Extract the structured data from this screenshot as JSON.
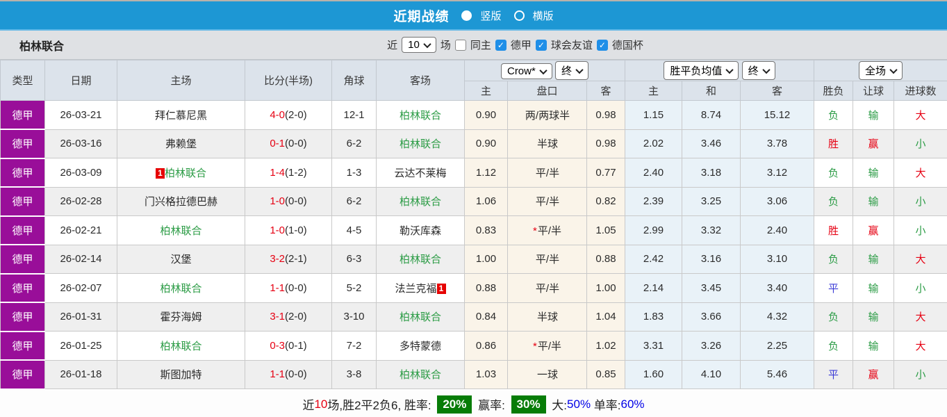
{
  "title_bar": {
    "title": "近期战绩",
    "radio_vertical": {
      "label": "竖版",
      "selected": true
    },
    "radio_horizontal": {
      "label": "横版",
      "selected": false
    }
  },
  "filter_bar": {
    "team_name": "柏林联合",
    "near_label": "近",
    "count_select": "10",
    "games_label": "场",
    "checkboxes": [
      {
        "label": "同主",
        "checked": false
      },
      {
        "label": "德甲",
        "checked": true
      },
      {
        "label": "球会友谊",
        "checked": true
      },
      {
        "label": "德国杯",
        "checked": true
      }
    ]
  },
  "table": {
    "main_headers": [
      "类型",
      "日期",
      "主场",
      "比分(半场)",
      "角球",
      "客场"
    ],
    "selects": {
      "handicap_source": "Crow*",
      "handicap_period": "终",
      "odds_source": "胜平负均值",
      "odds_period": "终",
      "scope": "全场"
    },
    "sub_headers": [
      "主",
      "盘口",
      "客",
      "主",
      "和",
      "客",
      "胜负",
      "让球",
      "进球数"
    ],
    "rows": [
      {
        "league": "德甲",
        "date": "26-03-21",
        "home": "拜仁慕尼黑",
        "home_badge": "",
        "home_is_team": false,
        "score": "4-0",
        "half": "(2-0)",
        "corner": "12-1",
        "away": "柏林联合",
        "away_badge": "",
        "away_is_team": true,
        "ah_home": "0.90",
        "ah_star": "",
        "ah_line": "两/两球半",
        "ah_away": "0.98",
        "odd_home": "1.15",
        "odd_draw": "8.74",
        "odd_away": "15.12",
        "res": "负",
        "res_color": "green",
        "ahres": "输",
        "ahres_color": "green",
        "goal": "大",
        "goal_color": "red"
      },
      {
        "league": "德甲",
        "date": "26-03-16",
        "home": "弗赖堡",
        "home_badge": "",
        "home_is_team": false,
        "score": "0-1",
        "half": "(0-0)",
        "corner": "6-2",
        "away": "柏林联合",
        "away_badge": "",
        "away_is_team": true,
        "ah_home": "0.90",
        "ah_star": "",
        "ah_line": "半球",
        "ah_away": "0.98",
        "odd_home": "2.02",
        "odd_draw": "3.46",
        "odd_away": "3.78",
        "res": "胜",
        "res_color": "red",
        "ahres": "赢",
        "ahres_color": "red",
        "goal": "小",
        "goal_color": "green"
      },
      {
        "league": "德甲",
        "date": "26-03-09",
        "home": "柏林联合",
        "home_badge": "1",
        "home_is_team": true,
        "score": "1-4",
        "half": "(1-2)",
        "corner": "1-3",
        "away": "云达不莱梅",
        "away_badge": "",
        "away_is_team": false,
        "ah_home": "1.12",
        "ah_star": "",
        "ah_line": "平/半",
        "ah_away": "0.77",
        "odd_home": "2.40",
        "odd_draw": "3.18",
        "odd_away": "3.12",
        "res": "负",
        "res_color": "green",
        "ahres": "输",
        "ahres_color": "green",
        "goal": "大",
        "goal_color": "red"
      },
      {
        "league": "德甲",
        "date": "26-02-28",
        "home": "门兴格拉德巴赫",
        "home_badge": "",
        "home_is_team": false,
        "score": "1-0",
        "half": "(0-0)",
        "corner": "6-2",
        "away": "柏林联合",
        "away_badge": "",
        "away_is_team": true,
        "ah_home": "1.06",
        "ah_star": "",
        "ah_line": "平/半",
        "ah_away": "0.82",
        "odd_home": "2.39",
        "odd_draw": "3.25",
        "odd_away": "3.06",
        "res": "负",
        "res_color": "green",
        "ahres": "输",
        "ahres_color": "green",
        "goal": "小",
        "goal_color": "green"
      },
      {
        "league": "德甲",
        "date": "26-02-21",
        "home": "柏林联合",
        "home_badge": "",
        "home_is_team": true,
        "score": "1-0",
        "half": "(1-0)",
        "corner": "4-5",
        "away": "勒沃库森",
        "away_badge": "",
        "away_is_team": false,
        "ah_home": "0.83",
        "ah_star": "*",
        "ah_line": "平/半",
        "ah_away": "1.05",
        "odd_home": "2.99",
        "odd_draw": "3.32",
        "odd_away": "2.40",
        "res": "胜",
        "res_color": "red",
        "ahres": "赢",
        "ahres_color": "red",
        "goal": "小",
        "goal_color": "green"
      },
      {
        "league": "德甲",
        "date": "26-02-14",
        "home": "汉堡",
        "home_badge": "",
        "home_is_team": false,
        "score": "3-2",
        "half": "(2-1)",
        "corner": "6-3",
        "away": "柏林联合",
        "away_badge": "",
        "away_is_team": true,
        "ah_home": "1.00",
        "ah_star": "",
        "ah_line": "平/半",
        "ah_away": "0.88",
        "odd_home": "2.42",
        "odd_draw": "3.16",
        "odd_away": "3.10",
        "res": "负",
        "res_color": "green",
        "ahres": "输",
        "ahres_color": "green",
        "goal": "大",
        "goal_color": "red"
      },
      {
        "league": "德甲",
        "date": "26-02-07",
        "home": "柏林联合",
        "home_badge": "",
        "home_is_team": true,
        "score": "1-1",
        "half": "(0-0)",
        "corner": "5-2",
        "away": "法兰克福",
        "away_badge": "1",
        "away_is_team": false,
        "ah_home": "0.88",
        "ah_star": "",
        "ah_line": "平/半",
        "ah_away": "1.00",
        "odd_home": "2.14",
        "odd_draw": "3.45",
        "odd_away": "3.40",
        "res": "平",
        "res_color": "blue",
        "ahres": "输",
        "ahres_color": "green",
        "goal": "小",
        "goal_color": "green"
      },
      {
        "league": "德甲",
        "date": "26-01-31",
        "home": "霍芬海姆",
        "home_badge": "",
        "home_is_team": false,
        "score": "3-1",
        "half": "(2-0)",
        "corner": "3-10",
        "away": "柏林联合",
        "away_badge": "",
        "away_is_team": true,
        "ah_home": "0.84",
        "ah_star": "",
        "ah_line": "半球",
        "ah_away": "1.04",
        "odd_home": "1.83",
        "odd_draw": "3.66",
        "odd_away": "4.32",
        "res": "负",
        "res_color": "green",
        "ahres": "输",
        "ahres_color": "green",
        "goal": "大",
        "goal_color": "red"
      },
      {
        "league": "德甲",
        "date": "26-01-25",
        "home": "柏林联合",
        "home_badge": "",
        "home_is_team": true,
        "score": "0-3",
        "half": "(0-1)",
        "corner": "7-2",
        "away": "多特蒙德",
        "away_badge": "",
        "away_is_team": false,
        "ah_home": "0.86",
        "ah_star": "*",
        "ah_line": "平/半",
        "ah_away": "1.02",
        "odd_home": "3.31",
        "odd_draw": "3.26",
        "odd_away": "2.25",
        "res": "负",
        "res_color": "green",
        "ahres": "输",
        "ahres_color": "green",
        "goal": "大",
        "goal_color": "red"
      },
      {
        "league": "德甲",
        "date": "26-01-18",
        "home": "斯图加特",
        "home_badge": "",
        "home_is_team": false,
        "score": "1-1",
        "half": "(0-0)",
        "corner": "3-8",
        "away": "柏林联合",
        "away_badge": "",
        "away_is_team": true,
        "ah_home": "1.03",
        "ah_star": "",
        "ah_line": "一球",
        "ah_away": "0.85",
        "odd_home": "1.60",
        "odd_draw": "4.10",
        "odd_away": "5.46",
        "res": "平",
        "res_color": "blue",
        "ahres": "赢",
        "ahres_color": "red",
        "goal": "小",
        "goal_color": "green"
      }
    ]
  },
  "summary": {
    "segments": [
      {
        "text": "近",
        "type": "text"
      },
      {
        "text": "10",
        "type": "red"
      },
      {
        "text": "场,胜2平2负6, 胜率: ",
        "type": "text"
      },
      {
        "text": "20%",
        "type": "badge"
      },
      {
        "text": " 赢率: ",
        "type": "text"
      },
      {
        "text": "30%",
        "type": "badge"
      },
      {
        "text": " 大:",
        "type": "text"
      },
      {
        "text": "50%",
        "type": "blue"
      },
      {
        "text": " 单率:",
        "type": "text"
      },
      {
        "text": "60%",
        "type": "blue"
      }
    ]
  },
  "colors": {
    "header_blue": "#1d97d4",
    "league_purple": "#990e99",
    "team_green": "#2c9c46",
    "score_red": "#e60012",
    "result_blue": "#3b3bd6",
    "badge_green": "#077c07",
    "percent_blue": "#0000e6",
    "checkbox_blue": "#1f8fe8"
  }
}
